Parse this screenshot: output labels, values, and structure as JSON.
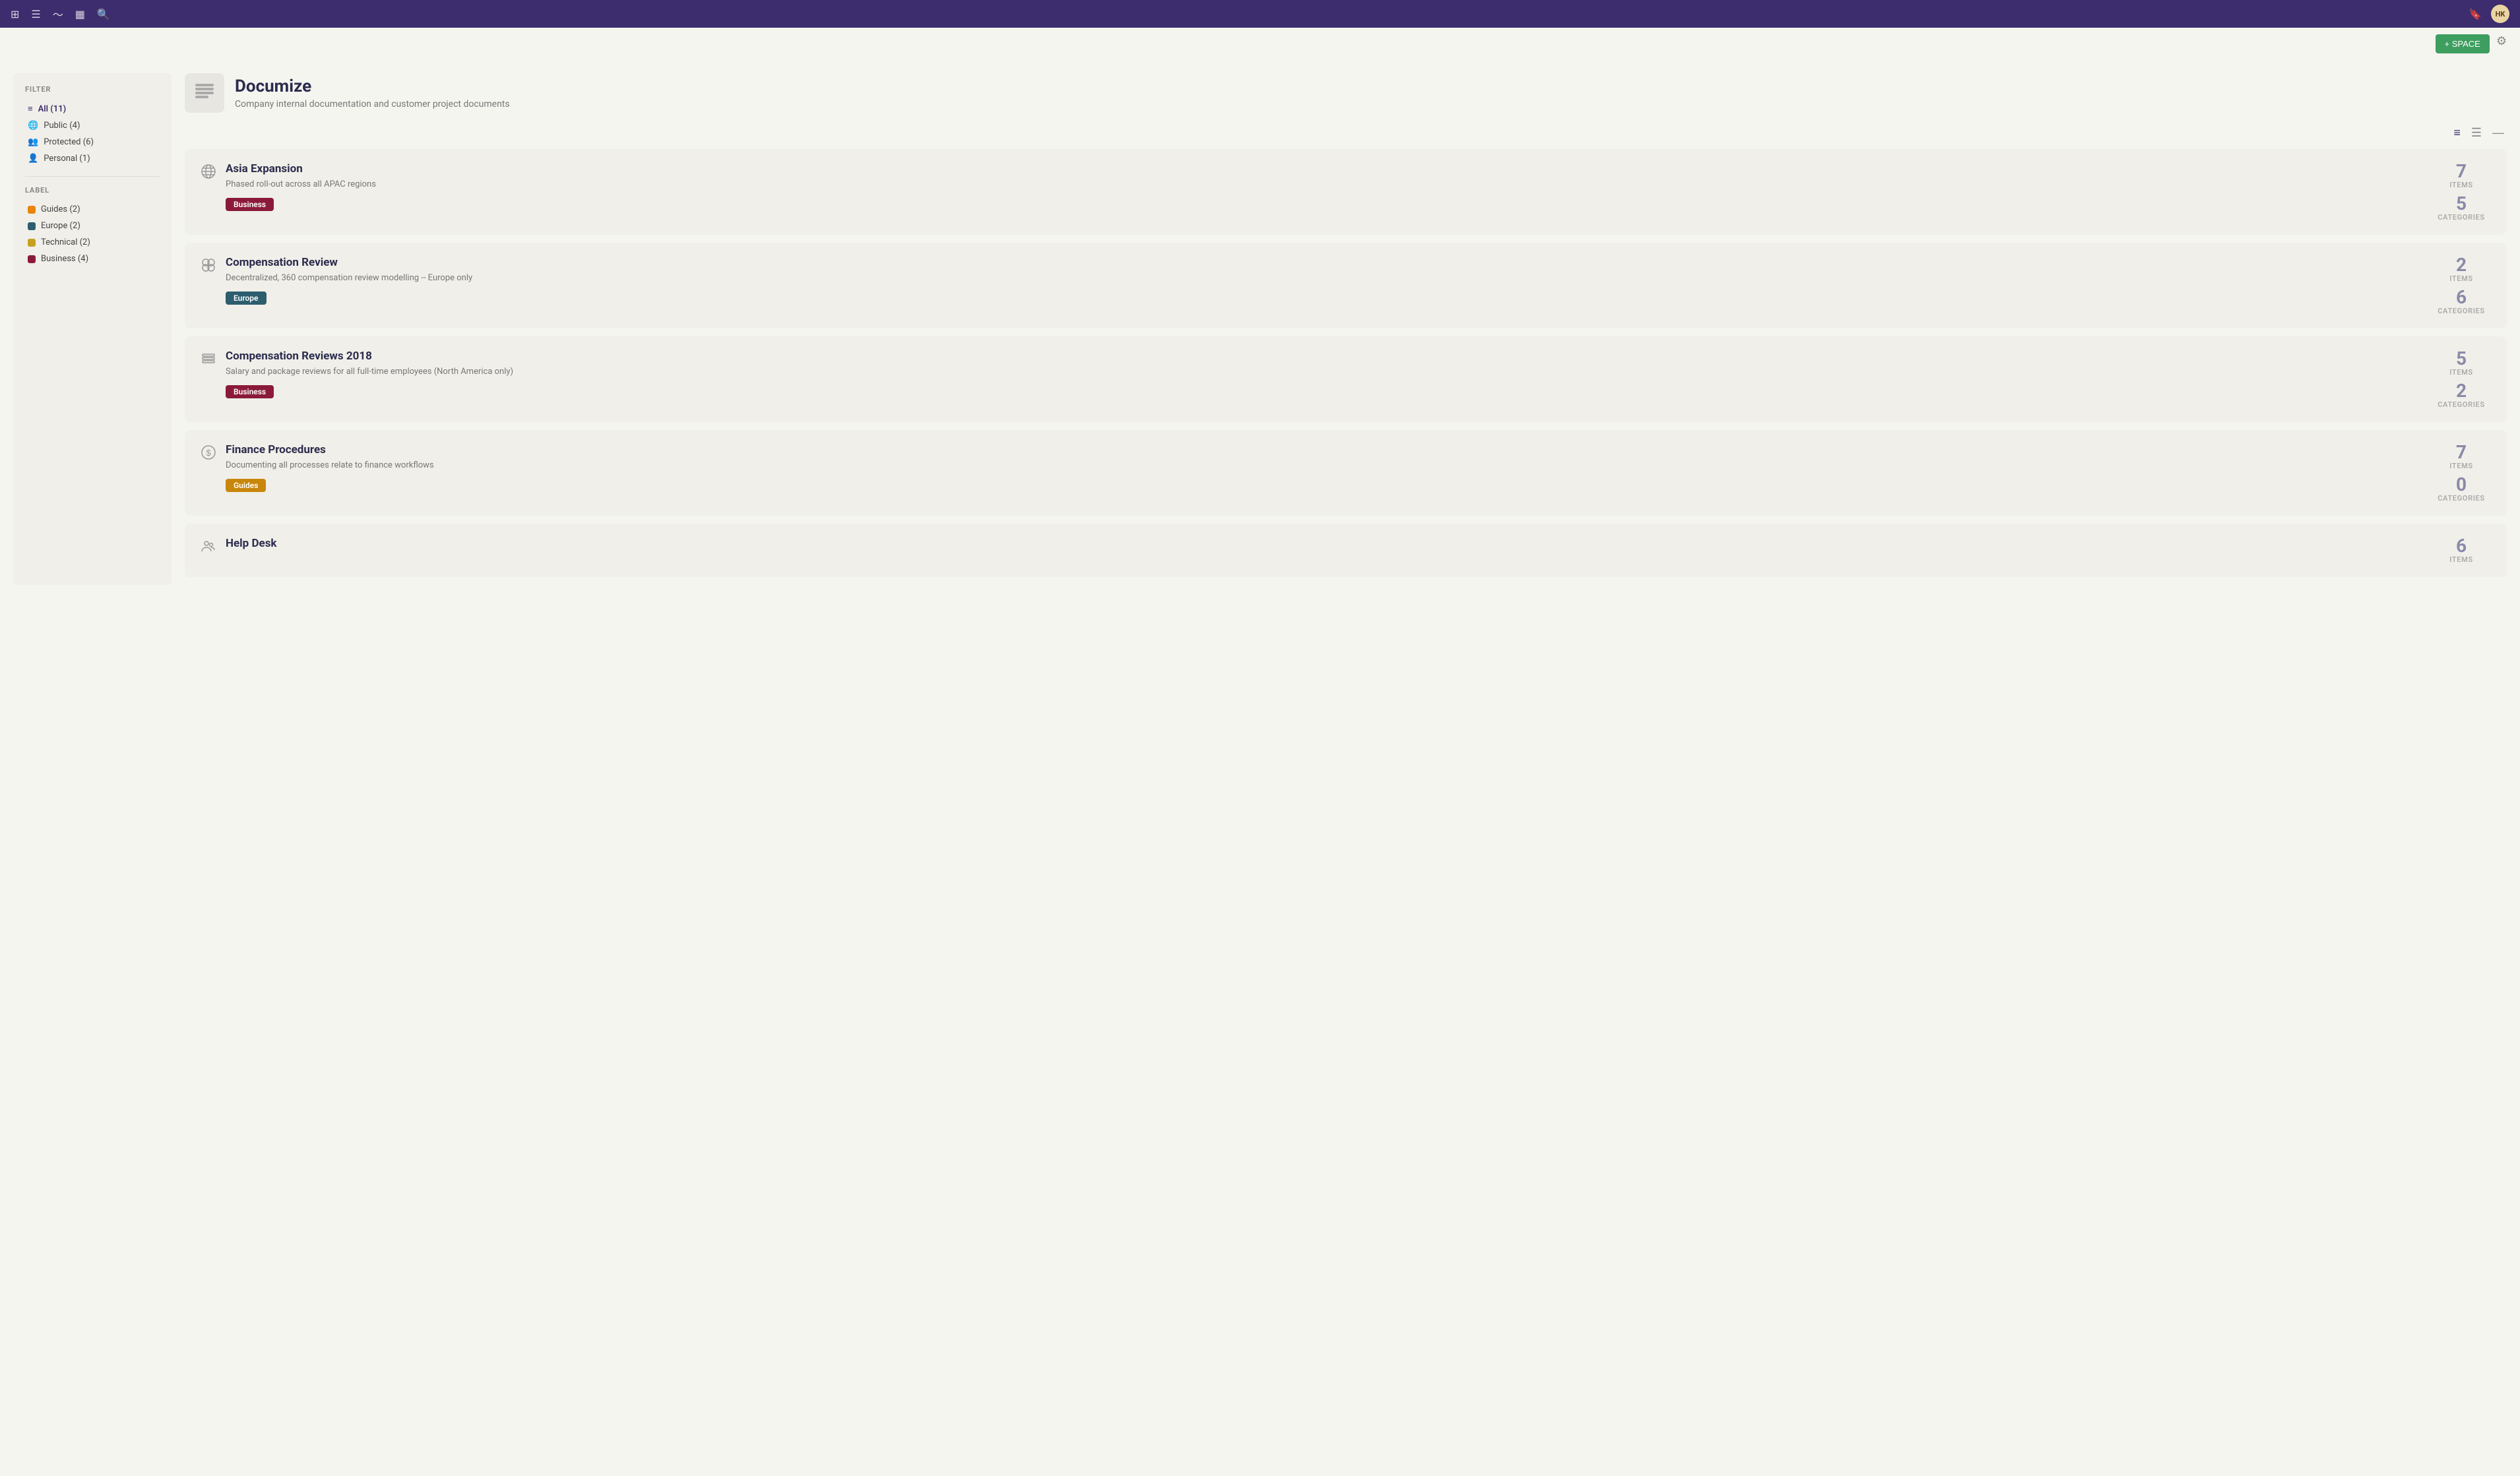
{
  "nav": {
    "icons": [
      "grid-icon",
      "list-icon",
      "activity-icon",
      "chart-icon",
      "search-icon"
    ],
    "avatar_text": "HK",
    "add_space_label": "+ SPACE"
  },
  "filter": {
    "section_title": "FILTER",
    "items": [
      {
        "label": "All (11)",
        "type": "all",
        "active": true
      },
      {
        "label": "Public (4)",
        "type": "public"
      },
      {
        "label": "Protected (6)",
        "type": "protected"
      },
      {
        "label": "Personal (1)",
        "type": "personal"
      }
    ]
  },
  "label": {
    "section_title": "LABEL",
    "items": [
      {
        "label": "Guides (2)",
        "color": "#e8860a"
      },
      {
        "label": "Europe (2)",
        "color": "#2c5e6e"
      },
      {
        "label": "Technical (2)",
        "color": "#c8a020"
      },
      {
        "label": "Business (4)",
        "color": "#8b1a3a"
      }
    ]
  },
  "space": {
    "title": "Documize",
    "description": "Company internal documentation and customer project documents"
  },
  "cards": [
    {
      "title": "Asia Expansion",
      "description": "Phased roll-out across all APAC regions",
      "tag": "Business",
      "tag_class": "tag-business",
      "items": 7,
      "categories": 5
    },
    {
      "title": "Compensation Review",
      "description": "Decentralized, 360 compensation review modelling -- Europe only",
      "tag": "Europe",
      "tag_class": "tag-europe",
      "items": 2,
      "categories": 6
    },
    {
      "title": "Compensation Reviews 2018",
      "description": "Salary and package reviews for all full-time employees (North America only)",
      "tag": "Business",
      "tag_class": "tag-business",
      "items": 5,
      "categories": 2
    },
    {
      "title": "Finance Procedures",
      "description": "Documenting all processes relate to finance workflows",
      "tag": "Guides",
      "tag_class": "tag-guides",
      "items": 7,
      "categories": 0
    },
    {
      "title": "Help Desk",
      "description": "",
      "tag": "",
      "tag_class": "",
      "items": 6,
      "categories": null
    }
  ],
  "labels": {
    "items": "ITEMS",
    "categories": "CATEGORIES"
  }
}
